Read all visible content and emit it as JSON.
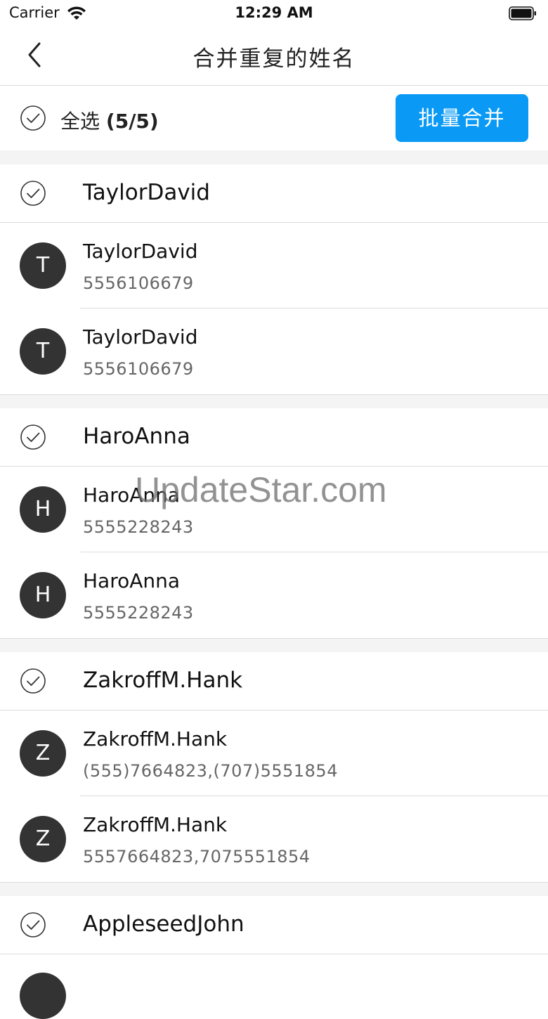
{
  "status_bar": {
    "carrier": "Carrier",
    "time": "12:29 AM"
  },
  "nav": {
    "title": "合并重复的姓名"
  },
  "toolbar": {
    "select_all_label": "全选",
    "select_all_count": "(5/5)",
    "merge_button": "批量合并"
  },
  "groups": [
    {
      "name": "TaylorDavid",
      "contacts": [
        {
          "initial": "T",
          "name": "TaylorDavid",
          "phone": "5556106679"
        },
        {
          "initial": "T",
          "name": "TaylorDavid",
          "phone": "5556106679"
        }
      ]
    },
    {
      "name": "HaroAnna",
      "contacts": [
        {
          "initial": "H",
          "name": "HaroAnna",
          "phone": "5555228243"
        },
        {
          "initial": "H",
          "name": "HaroAnna",
          "phone": "5555228243"
        }
      ]
    },
    {
      "name": "ZakroffM.Hank",
      "contacts": [
        {
          "initial": "Z",
          "name": "ZakroffM.Hank",
          "phone": "(555)7664823,(707)5551854"
        },
        {
          "initial": "Z",
          "name": "ZakroffM.Hank",
          "phone": "5557664823,7075551854"
        }
      ]
    },
    {
      "name": "AppleseedJohn",
      "contacts": []
    }
  ],
  "watermark": "UpdateStar.com",
  "colors": {
    "accent": "#0a9af5",
    "avatar": "#333333",
    "separator": "#dcdcdc"
  }
}
